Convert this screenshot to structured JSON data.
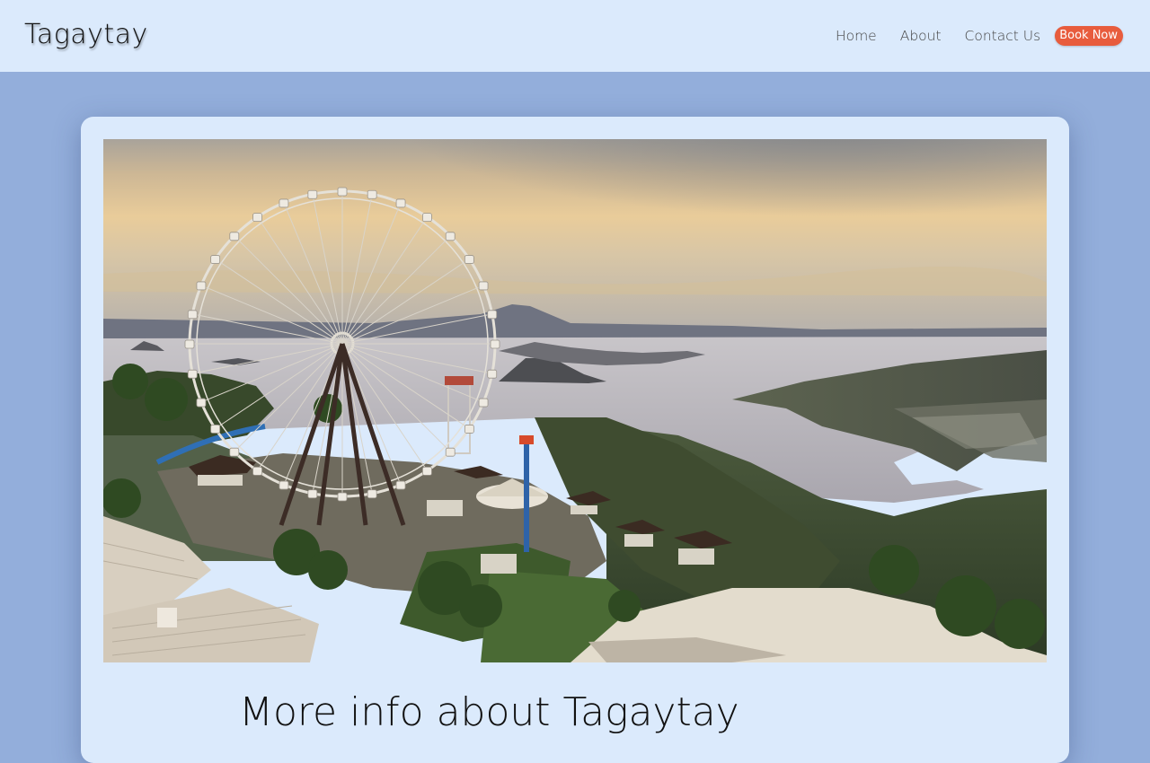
{
  "navbar": {
    "brand": "Tagaytay",
    "links": [
      {
        "label": "Home"
      },
      {
        "label": "About"
      },
      {
        "label": "Contact Us"
      }
    ],
    "cta_label": "Book Now"
  },
  "hero": {
    "image_alt": "Aerial view of Tagaytay theme park with ferris wheel overlooking Taal Lake and volcano"
  },
  "main": {
    "heading": "More info about Tagaytay"
  },
  "colors": {
    "page_background": "#93aedb",
    "navbar_background": "#dbeafc",
    "card_background": "#dbeafc",
    "cta_background": "#e85c3d"
  }
}
